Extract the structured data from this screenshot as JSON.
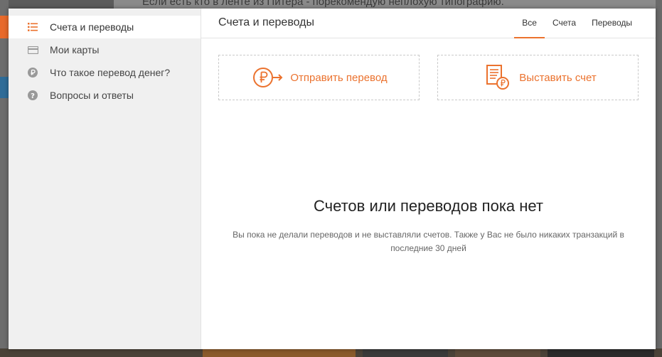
{
  "background": {
    "top_text": "Если есть кто в ленте из Питера - порекомендую неплохую типографию."
  },
  "sidebar": {
    "items": [
      {
        "label": "Счета и переводы",
        "icon": "list-icon",
        "active": true
      },
      {
        "label": "Мои карты",
        "icon": "card-icon",
        "active": false
      },
      {
        "label": "Что такое перевод денег?",
        "icon": "ruble-coin-icon",
        "active": false
      },
      {
        "label": "Вопросы и ответы",
        "icon": "question-icon",
        "active": false
      }
    ]
  },
  "header": {
    "title": "Счета и переводы",
    "tabs": [
      {
        "label": "Все",
        "active": true
      },
      {
        "label": "Счета",
        "active": false
      },
      {
        "label": "Переводы",
        "active": false
      }
    ]
  },
  "actions": {
    "send_label": "Отправить перевод",
    "invoice_label": "Выставить счет"
  },
  "empty": {
    "title": "Счетов или переводов пока нет",
    "text": "Вы пока не делали переводов и не выставляли счетов. Также у Вас не было никаких транзакций в последние 30 дней"
  },
  "colors": {
    "accent": "#eb722e",
    "sidebar_bg": "#f0f0f0"
  }
}
